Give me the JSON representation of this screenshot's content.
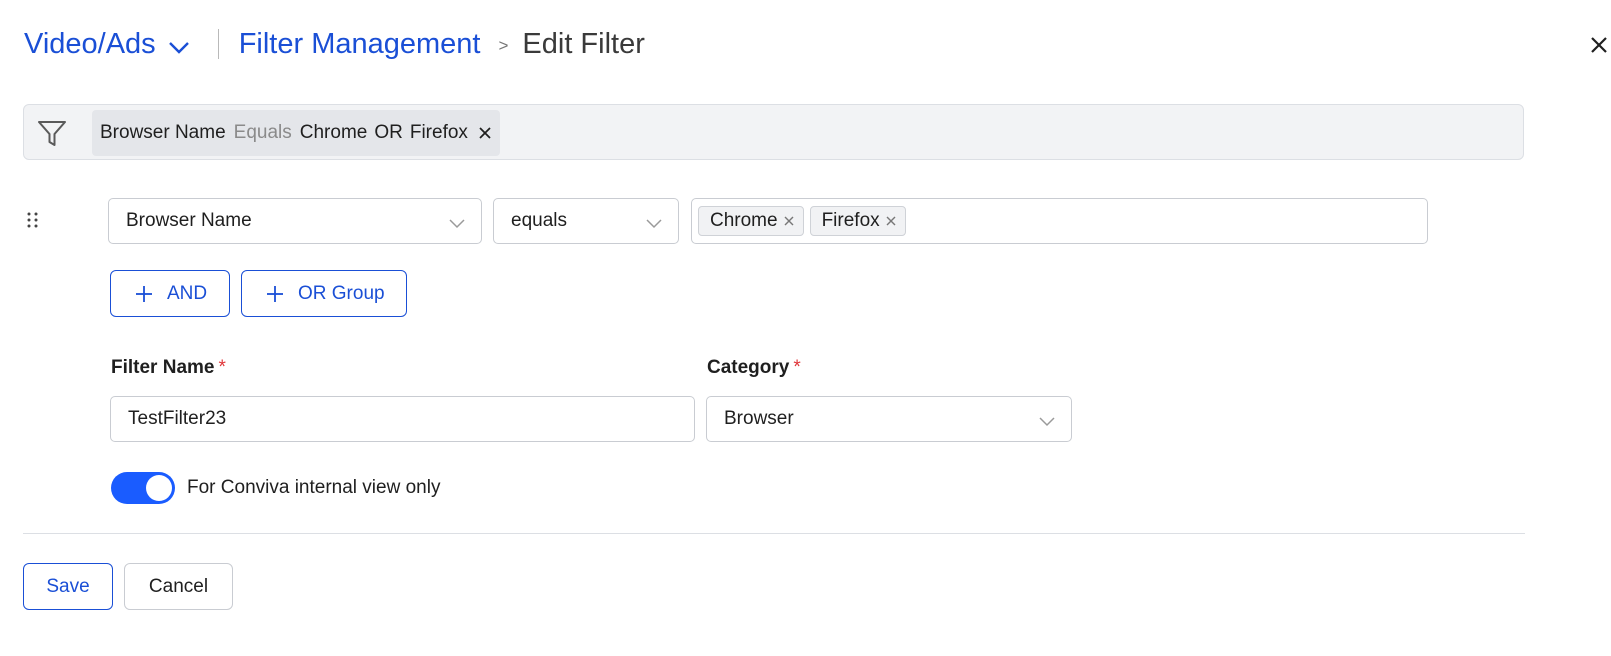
{
  "header": {
    "app_name": "Video/Ads",
    "breadcrumb_link": "Filter Management",
    "breadcrumb_separator": ">",
    "page_title": "Edit Filter"
  },
  "filter_summary": {
    "field": "Browser Name",
    "operator": "Equals",
    "value_1": "Chrome",
    "joiner": "OR",
    "value_2": "Firefox"
  },
  "condition": {
    "field": "Browser Name",
    "operator": "equals",
    "values": [
      "Chrome",
      "Firefox"
    ]
  },
  "actions": {
    "and_label": "AND",
    "or_group_label": "OR Group"
  },
  "form": {
    "filter_name_label": "Filter Name",
    "filter_name_value": "TestFilter23",
    "category_label": "Category",
    "category_value": "Browser",
    "required_marker": "*",
    "internal_only_label": "For Conviva internal view only",
    "internal_only_enabled": true
  },
  "footer": {
    "save_label": "Save",
    "cancel_label": "Cancel"
  },
  "colors": {
    "accent": "#1a4fd6",
    "toggle_on": "#1a5cff",
    "required": "#e0363a"
  },
  "icons": [
    "chevron-down-icon",
    "close-icon",
    "funnel-icon",
    "drag-handle-icon",
    "plus-icon",
    "remove-tag-icon"
  ]
}
